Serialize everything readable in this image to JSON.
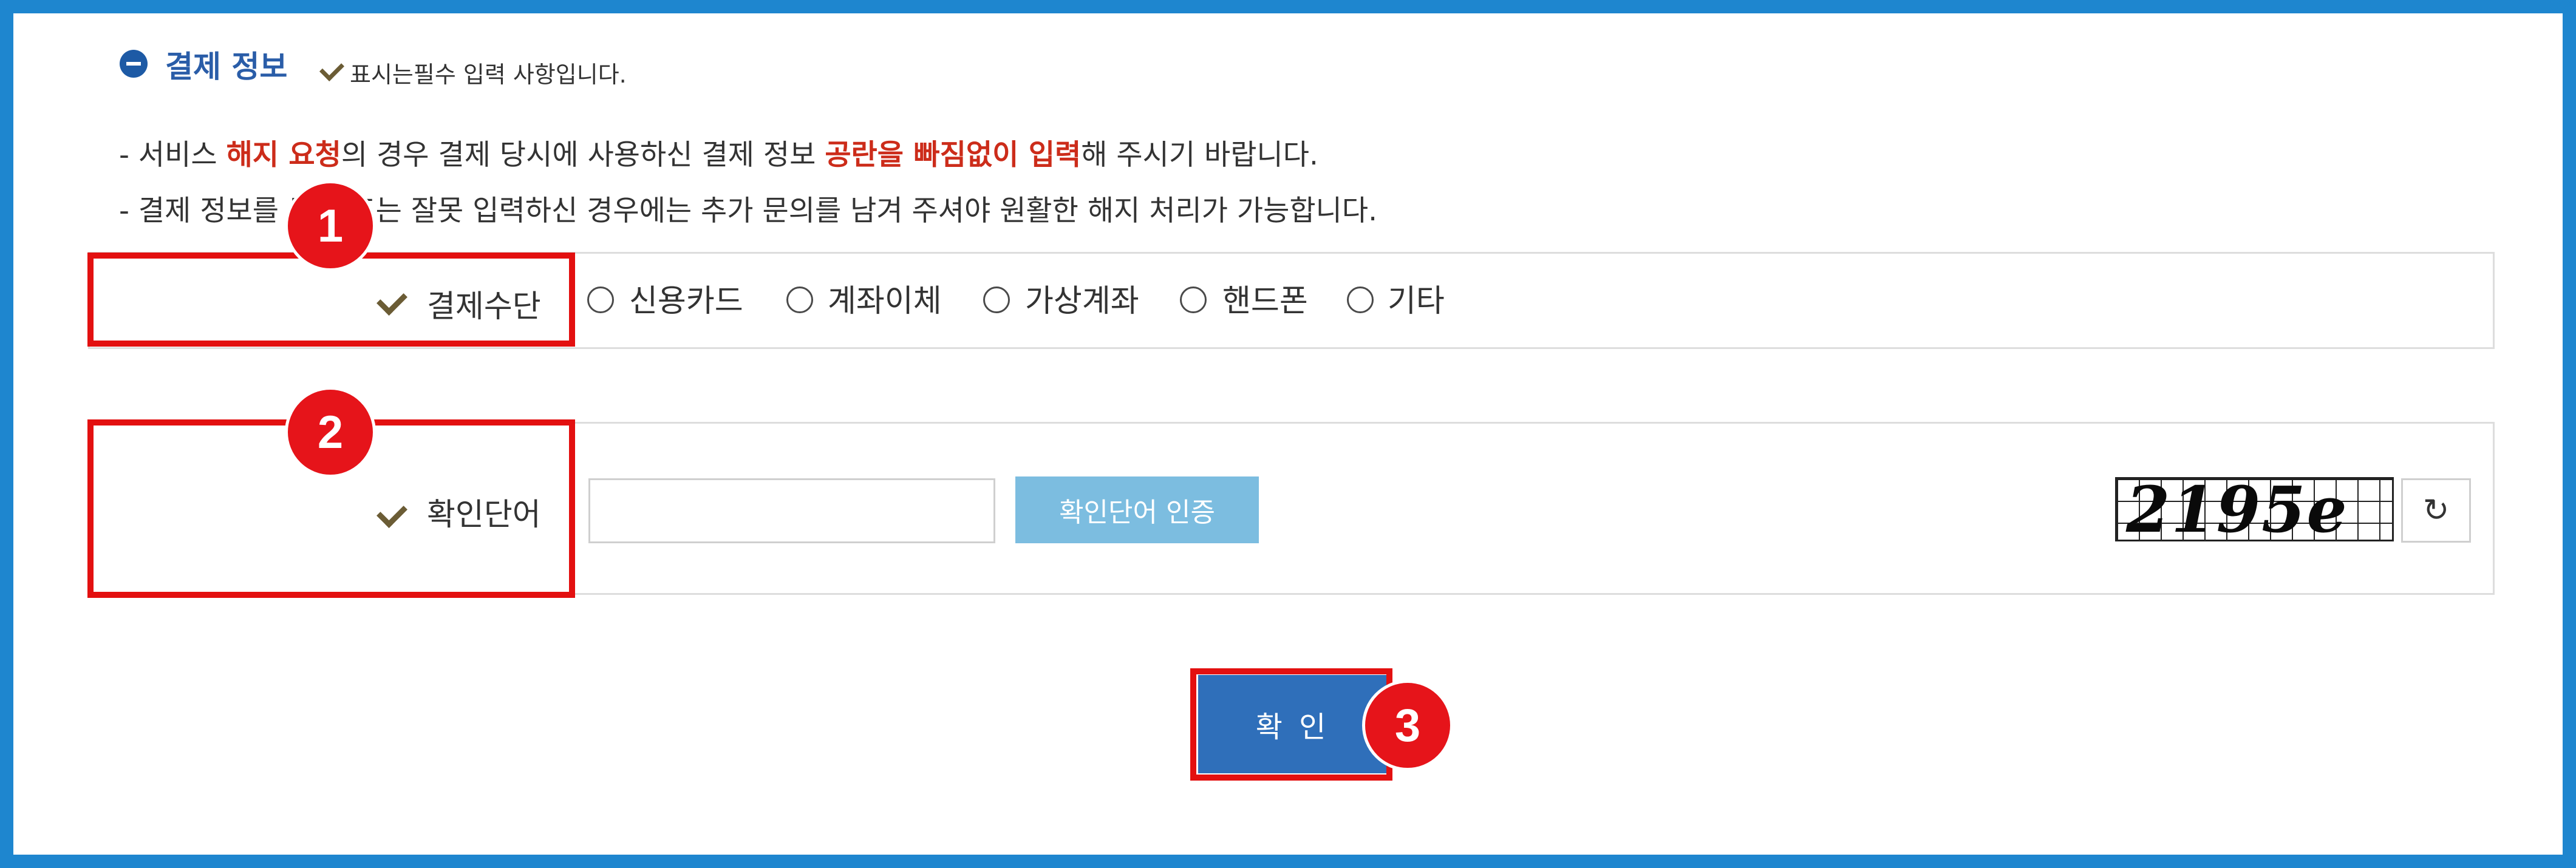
{
  "section": {
    "title": "결제 정보",
    "required_note": "표시는필수 입력 사항입니다."
  },
  "notices": {
    "line1": {
      "prefix": "- 서비스 ",
      "emph1": "해지 요청",
      "mid": "의 경우 결제 당시에 사용하신 결제 정보 ",
      "emph2": "공란을 빠짐없이 입력",
      "suffix": "해 주시기 바랍니다."
    },
    "line2": "- 결제 정보를 누락 또는 잘못 입력하신 경우에는 추가 문의를 남겨 주셔야 원활한 해지 처리가 가능합니다."
  },
  "payment_method": {
    "label": "결제수단",
    "options": [
      "신용카드",
      "계좌이체",
      "가상계좌",
      "핸드폰",
      "기타"
    ]
  },
  "captcha": {
    "label": "확인단어",
    "input_value": "",
    "verify_button": "확인단어 인증",
    "image_text": "2195e",
    "refresh_icon": "↻"
  },
  "submit": {
    "label": "확 인"
  },
  "annotations": {
    "badge1": "1",
    "badge2": "2",
    "badge3": "3"
  },
  "colors": {
    "accent": "#1e86cf",
    "highlight": "#e31010",
    "button": "#2f6fba",
    "verify": "#7cbde0",
    "emphasis": "#cc2c1a"
  }
}
